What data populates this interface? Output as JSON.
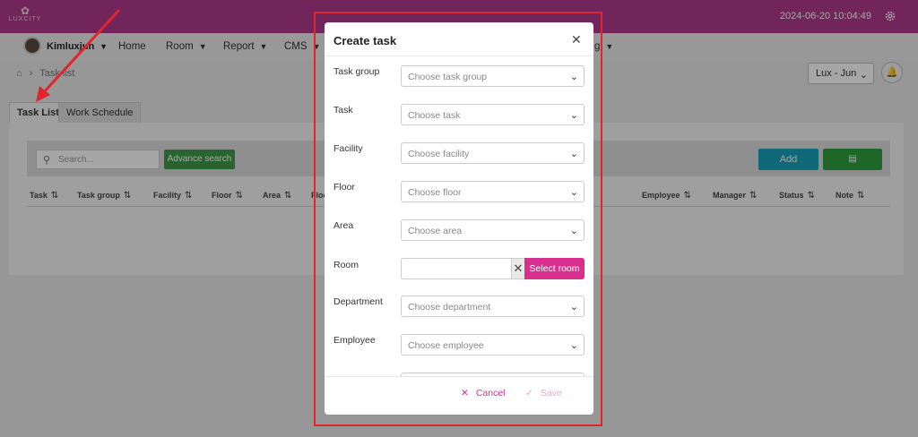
{
  "app": {
    "logo_text": "LUXCITY",
    "datetime": "2024-06-20 10:04:49"
  },
  "nav": {
    "user": "Kimluxjun",
    "items": [
      "Home",
      "Room",
      "Report",
      "CMS"
    ],
    "partial_item": "g"
  },
  "breadcrumb": {
    "current": "Task list"
  },
  "header_right": {
    "language": "Lux - Jun"
  },
  "tabs": [
    {
      "label": "Task List",
      "active": true
    },
    {
      "label": "Work Schedule",
      "active": false
    }
  ],
  "toolbar": {
    "search_placeholder": "Search...",
    "advance_search_label": "Advance search",
    "add_label": "Add"
  },
  "table": {
    "columns_left": [
      "Task",
      "Task group",
      "Facility",
      "Floor",
      "Area",
      "Floo"
    ],
    "columns_right": [
      "Employee",
      "Manager",
      "Status",
      "Note"
    ]
  },
  "modal": {
    "title": "Create task",
    "fields": [
      {
        "label": "Task group",
        "placeholder": "Choose task group"
      },
      {
        "label": "Task",
        "placeholder": "Choose task"
      },
      {
        "label": "Facility",
        "placeholder": "Choose facility"
      },
      {
        "label": "Floor",
        "placeholder": "Choose floor"
      },
      {
        "label": "Area",
        "placeholder": "Choose area"
      },
      {
        "label": "Room",
        "button": "Select room"
      },
      {
        "label": "Department",
        "placeholder": "Choose department"
      },
      {
        "label": "Employee",
        "placeholder": "Choose employee"
      }
    ],
    "cancel_label": "Cancel",
    "save_label": "Save"
  },
  "colors": {
    "brand": "#b03a8a",
    "accent_pink": "#d92f8f",
    "highlight_red": "#e0262c"
  }
}
